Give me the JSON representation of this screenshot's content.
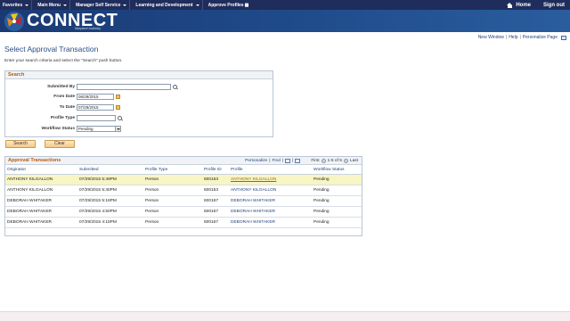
{
  "topnav": {
    "items": [
      "Favorites",
      "Main Menu",
      "Manager Self Service",
      "Learning and Development",
      "Approve Profiles"
    ],
    "home": "Home",
    "signout": "Sign out"
  },
  "banner": {
    "title": "CONNECT",
    "subtitle": "Maryland Judiciary"
  },
  "toplinks": {
    "new_window": "New Window",
    "help": "Help",
    "personalize": "Personalize Page"
  },
  "page": {
    "title": "Select Approval Transaction",
    "instructions": "Enter your search criteria and select the \"Search\" push button."
  },
  "search": {
    "header": "Search",
    "submitted_by_label": "Submitted By",
    "submitted_by_value": "",
    "from_date_label": "From Date",
    "from_date_value": "06/29/2015",
    "to_date_label": "To Date",
    "to_date_value": "07/29/2015",
    "profile_type_label": "Profile Type",
    "profile_type_value": "",
    "workflow_status_label": "Workflow Status",
    "workflow_status_value": "Pending",
    "search_button": "Search",
    "clear_button": "Clear"
  },
  "grid": {
    "title": "Approval Transactions",
    "personalize": "Personalize",
    "find": "Find",
    "first": "First",
    "range": "1-5 of 5",
    "last": "Last",
    "columns": [
      "Originator",
      "Submitted",
      "Profile Type",
      "Profile ID",
      "Profile",
      "Workflow Status"
    ],
    "rows": [
      {
        "originator": "ANTHONY KILGALLON",
        "submitted": "07/29/2015 5:49PM",
        "profile_type": "Person",
        "profile_id": "600153",
        "profile": "ANTHONY KILGALLON",
        "status": "Pending"
      },
      {
        "originator": "ANTHONY KILGALLON",
        "submitted": "07/29/2015 5:40PM",
        "profile_type": "Person",
        "profile_id": "600153",
        "profile": "ANTHONY KILGALLON",
        "status": "Pending"
      },
      {
        "originator": "DEBORAH WHITAKER",
        "submitted": "07/29/2015 5:16PM",
        "profile_type": "Person",
        "profile_id": "600167",
        "profile": "DEBORAH WHITAKER",
        "status": "Pending"
      },
      {
        "originator": "DEBORAH WHITAKER",
        "submitted": "07/29/2015 4:50PM",
        "profile_type": "Person",
        "profile_id": "600167",
        "profile": "DEBORAH WHITAKER",
        "status": "Pending"
      },
      {
        "originator": "DEBORAH WHITAKER",
        "submitted": "07/29/2015 4:15PM",
        "profile_type": "Person",
        "profile_id": "600167",
        "profile": "DEBORAH WHITAKER",
        "status": "Pending"
      }
    ]
  },
  "colors": {
    "nav_bg": "#1f2d5c",
    "banner_bg": "#1f4a8a",
    "section_title": "#b85a0b",
    "link": "#1f3f7a",
    "highlight_row": "#f8f5c4"
  }
}
